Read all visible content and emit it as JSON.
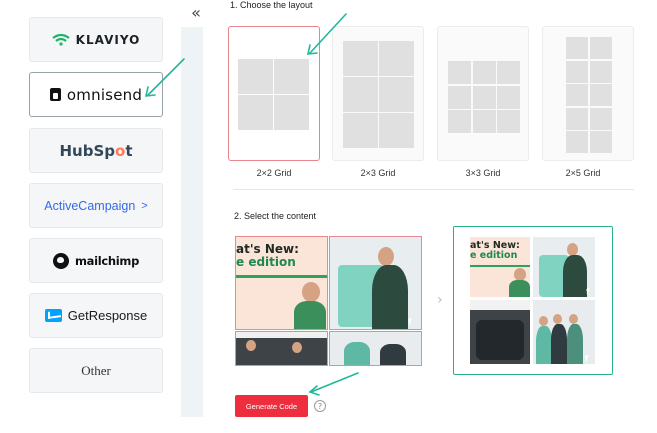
{
  "sidebar": {
    "collapse_glyph": "«",
    "providers": [
      {
        "id": "klaviyo",
        "label": "KLAVIYO",
        "selected": false
      },
      {
        "id": "omnisend",
        "label": "omnisend",
        "selected": true
      },
      {
        "id": "hubspot",
        "label_part1": "HubSp",
        "label_part2": "o",
        "label_part3": "t",
        "selected": false
      },
      {
        "id": "activecampaign",
        "label": "ActiveCampaign",
        "suffix": ">",
        "selected": false
      },
      {
        "id": "mailchimp",
        "label": "mailchimp",
        "selected": false
      },
      {
        "id": "getresponse",
        "label": "GetResponse",
        "selected": false
      },
      {
        "id": "other",
        "label": "Other",
        "selected": false
      }
    ]
  },
  "step1": {
    "title": "1. Choose the layout",
    "layouts": [
      {
        "label": "2×2 Grid",
        "selected": true
      },
      {
        "label": "2×3 Grid",
        "selected": false
      },
      {
        "label": "3×3 Grid",
        "selected": false
      },
      {
        "label": "2×5 Grid",
        "selected": false
      }
    ]
  },
  "step2": {
    "title": "2. Select the content",
    "post_text_line1": "at's New:",
    "post_text_line2": "e edition",
    "social_glyph": "f",
    "next_glyph": "›"
  },
  "actions": {
    "generate_label": "Generate Code",
    "help_glyph": "?"
  },
  "colors": {
    "accent_red": "#ee2e3e",
    "selected_border": "#e8848e",
    "target_border": "#28b08a",
    "annotation_arrow": "#1fb89a"
  }
}
